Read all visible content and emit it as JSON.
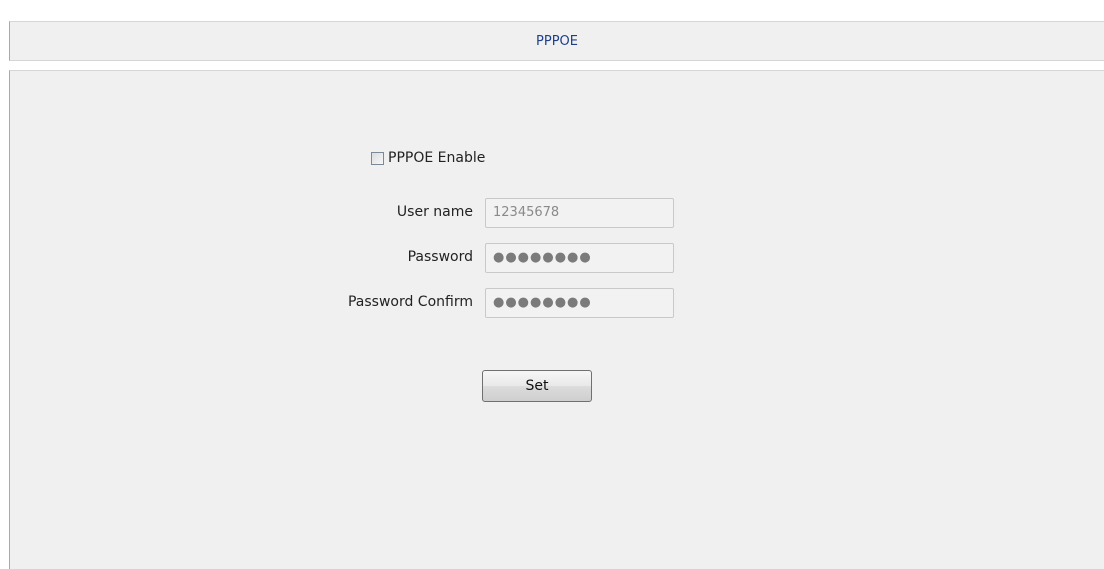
{
  "header": {
    "title": "PPPOE"
  },
  "form": {
    "enable_label": "PPPOE Enable",
    "enable_checked": false,
    "username_label": "User name",
    "username_value": "12345678",
    "password_label": "Password",
    "password_value": "●●●●●●●●",
    "password_confirm_label": "Password Confirm",
    "password_confirm_value": "●●●●●●●●",
    "set_label": "Set"
  }
}
